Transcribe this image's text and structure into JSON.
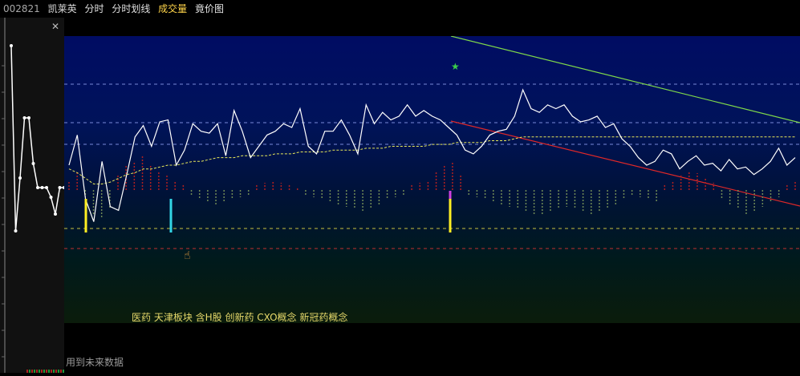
{
  "header": {
    "code": "002821",
    "name": "凯莱英",
    "tabs": [
      "分时",
      "分时划线",
      "成交量",
      "竟价图"
    ]
  },
  "concepts": "医药 天津板块 含H股 创新药 CXO概念 新冠药概念",
  "notice": "用到未来数据",
  "icons": {
    "close": "close-icon",
    "cursor": "hand-pointer-icon",
    "star": "star-icon"
  },
  "colors": {
    "price_line": "#ffffff",
    "avg_line": "#e8e85a",
    "upper_trend": "#7fd84a",
    "lower_trend": "#e02828",
    "up_bar": "#b02020",
    "down_bar": "#6f8a56",
    "signal_yellow": "#ffee22",
    "signal_cyan": "#33d6e6",
    "signal_magenta": "#d040e0"
  },
  "chart_data": {
    "type": "line",
    "price": [
      0.4,
      0.56,
      0.22,
      0.1,
      0.42,
      0.18,
      0.16,
      0.35,
      0.55,
      0.61,
      0.5,
      0.63,
      0.64,
      0.4,
      0.48,
      0.62,
      0.58,
      0.57,
      0.62,
      0.45,
      0.69,
      0.58,
      0.44,
      0.5,
      0.56,
      0.58,
      0.62,
      0.6,
      0.7,
      0.5,
      0.46,
      0.58,
      0.58,
      0.64,
      0.56,
      0.46,
      0.72,
      0.62,
      0.68,
      0.64,
      0.66,
      0.72,
      0.66,
      0.69,
      0.66,
      0.64,
      0.6,
      0.56,
      0.48,
      0.46,
      0.5,
      0.56,
      0.58,
      0.59,
      0.66,
      0.8,
      0.7,
      0.68,
      0.72,
      0.7,
      0.72,
      0.66,
      0.63,
      0.64,
      0.66,
      0.6,
      0.62,
      0.54,
      0.5,
      0.44,
      0.4,
      0.42,
      0.48,
      0.46,
      0.38,
      0.42,
      0.45,
      0.4,
      0.41,
      0.37,
      0.43,
      0.38,
      0.39,
      0.35,
      0.38,
      0.42,
      0.49,
      0.4,
      0.44
    ],
    "avg": [
      0.38,
      0.36,
      0.33,
      0.3,
      0.3,
      0.31,
      0.33,
      0.35,
      0.36,
      0.38,
      0.38,
      0.39,
      0.4,
      0.4,
      0.41,
      0.42,
      0.42,
      0.43,
      0.44,
      0.44,
      0.44,
      0.45,
      0.45,
      0.45,
      0.45,
      0.46,
      0.46,
      0.46,
      0.47,
      0.47,
      0.47,
      0.47,
      0.48,
      0.48,
      0.48,
      0.48,
      0.49,
      0.49,
      0.49,
      0.5,
      0.5,
      0.5,
      0.5,
      0.5,
      0.51,
      0.51,
      0.51,
      0.52,
      0.52,
      0.52,
      0.52,
      0.53,
      0.53,
      0.53,
      0.54,
      0.55,
      0.55,
      0.55,
      0.55,
      0.55,
      0.55,
      0.55,
      0.55,
      0.55,
      0.55,
      0.55,
      0.55,
      0.55,
      0.55,
      0.55,
      0.55,
      0.55,
      0.55,
      0.55,
      0.55,
      0.55,
      0.55,
      0.55,
      0.55,
      0.55,
      0.55,
      0.55,
      0.55,
      0.55,
      0.55,
      0.55,
      0.55,
      0.55,
      0.55
    ],
    "bars": [
      4,
      8,
      -3,
      -10,
      -12,
      -8,
      6,
      10,
      12,
      14,
      10,
      8,
      6,
      4,
      2,
      -2,
      -4,
      -5,
      -6,
      -5,
      -4,
      -3,
      -2,
      2,
      3,
      4,
      3,
      2,
      1,
      -2,
      -3,
      -4,
      -5,
      -6,
      -7,
      -8,
      -9,
      -8,
      -6,
      -4,
      -3,
      -2,
      2,
      3,
      4,
      8,
      10,
      12,
      6,
      -2,
      -3,
      -4,
      -5,
      -6,
      -7,
      -8,
      -9,
      -10,
      -10,
      -9,
      -8,
      -7,
      -8,
      -9,
      -10,
      -9,
      -8,
      -6,
      -4,
      -2,
      -3,
      -4,
      -5,
      2,
      4,
      6,
      8,
      7,
      5,
      3,
      -4,
      -6,
      -8,
      -10,
      -9,
      -7,
      -5,
      -3,
      2,
      4
    ],
    "signals": [
      "yellow",
      "cyan",
      "yellow"
    ],
    "price_levels": 4
  },
  "left_chart": {
    "type": "line",
    "points": [
      0.95,
      0.18,
      0.4,
      0.65,
      0.65,
      0.46,
      0.36,
      0.36,
      0.36,
      0.32,
      0.25,
      0.36,
      0.36
    ]
  }
}
